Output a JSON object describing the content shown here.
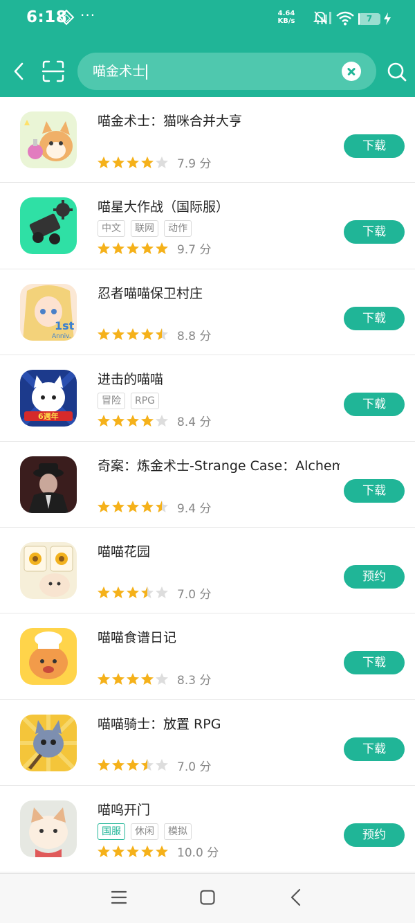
{
  "status_bar": {
    "time": "6:18",
    "dots": "···",
    "net_speed_value": "4.64",
    "net_speed_unit": "KB/s",
    "battery": "7",
    "battery_level": 0.07
  },
  "search": {
    "query": "喵金术士"
  },
  "theme": {
    "accent": "#20b597",
    "star_on": "#f5b11a",
    "star_off": "#dddddd"
  },
  "results": [
    {
      "title": "喵金术士：猫咪合并大亨",
      "tags": [],
      "rating": 4.0,
      "score": "7.9 分",
      "action": "下载",
      "icon": "cat-alchemist-icon"
    },
    {
      "title": "喵星大作战（国际服）",
      "tags": [
        "中文",
        "联网",
        "动作"
      ],
      "rating": 5.0,
      "score": "9.7 分",
      "action": "下载",
      "icon": "cannon-icon"
    },
    {
      "title": "忍者喵喵保卫村庄",
      "tags": [],
      "rating": 4.5,
      "score": "8.8 分",
      "action": "下载",
      "icon": "anime-girl-icon"
    },
    {
      "title": "进击的喵喵",
      "tags": [
        "冒险",
        "RPG"
      ],
      "rating": 4.0,
      "score": "8.4 分",
      "action": "下载",
      "icon": "white-cat-icon"
    },
    {
      "title": "奇案：炼金术士-Strange Case：Alchemist",
      "tags": [],
      "rating": 4.5,
      "score": "9.4 分",
      "action": "下载",
      "icon": "detective-icon"
    },
    {
      "title": "喵喵花园",
      "tags": [],
      "rating": 3.5,
      "score": "7.0 分",
      "action": "预约",
      "icon": "sunflower-cat-icon"
    },
    {
      "title": "喵喵食谱日记",
      "tags": [],
      "rating": 4.0,
      "score": "8.3 分",
      "action": "下载",
      "icon": "chef-cat-icon"
    },
    {
      "title": "喵喵骑士：放置 RPG",
      "tags": [],
      "rating": 3.5,
      "score": "7.0 分",
      "action": "下载",
      "icon": "knight-cat-icon"
    },
    {
      "title": "喵呜开门",
      "tags": [
        {
          "label": "国服",
          "highlight": true
        },
        "休闲",
        "模拟"
      ],
      "rating": 5.0,
      "score": "10.0 分",
      "action": "预约",
      "icon": "cute-cat-icon"
    }
  ]
}
